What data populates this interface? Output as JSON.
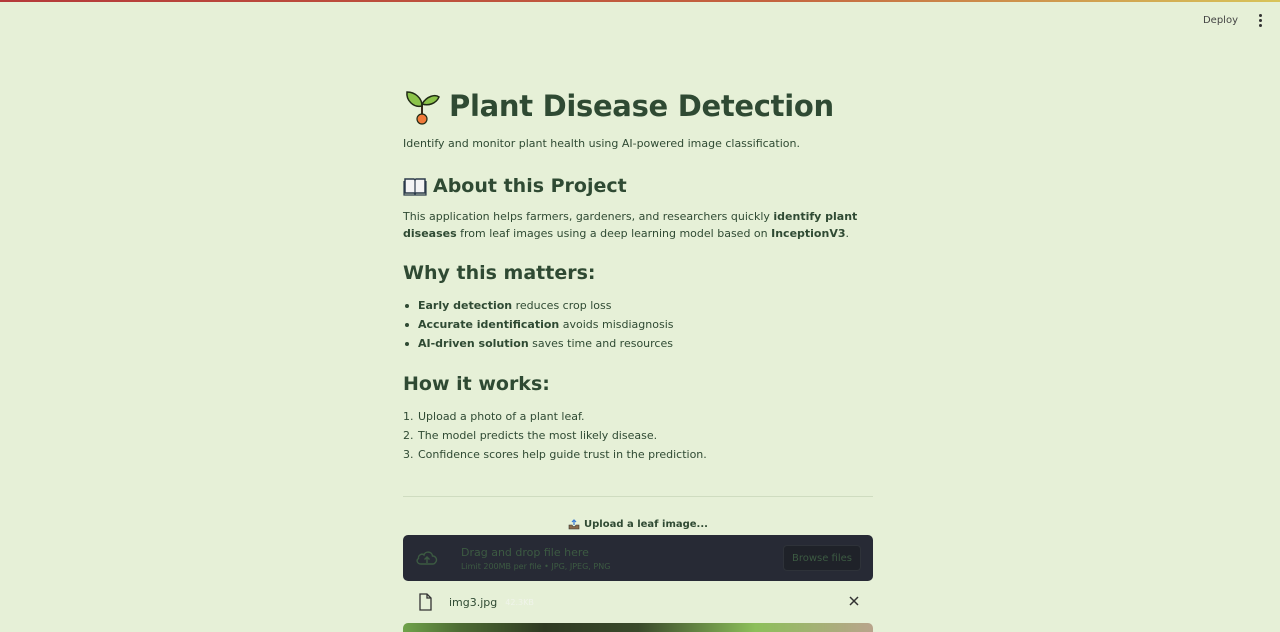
{
  "header": {
    "deploy_label": "Deploy"
  },
  "page": {
    "title": "Plant Disease Detection",
    "subtitle": "Identify and monitor plant health using AI-powered image classification."
  },
  "about": {
    "heading": "About this Project",
    "text_1": "This application helps farmers, gardeners, and researchers quickly ",
    "bold_1": "identify plant diseases",
    "text_2": " from leaf images using a deep learning model based on ",
    "bold_2": "InceptionV3",
    "text_3": "."
  },
  "why": {
    "heading": "Why this matters:",
    "items": [
      {
        "bold": "Early detection",
        "text": " reduces crop loss"
      },
      {
        "bold": "Accurate identification",
        "text": " avoids misdiagnosis"
      },
      {
        "bold": "AI-driven solution",
        "text": " saves time and resources"
      }
    ]
  },
  "how": {
    "heading": "How it works:",
    "steps": [
      {
        "num": "1.",
        "text": "Upload a photo of a plant leaf."
      },
      {
        "num": "2.",
        "text": "The model predicts the most likely disease."
      },
      {
        "num": "3.",
        "text": "Confidence scores help guide trust in the prediction."
      }
    ]
  },
  "uploader": {
    "label": "Upload a leaf image...",
    "drop_text": "Drag and drop file here",
    "limit_text": "Limit 200MB per file • JPG, JPEG, PNG",
    "browse_label": "Browse files",
    "file_name": "img3.jpg",
    "file_size": "42.3KB"
  }
}
